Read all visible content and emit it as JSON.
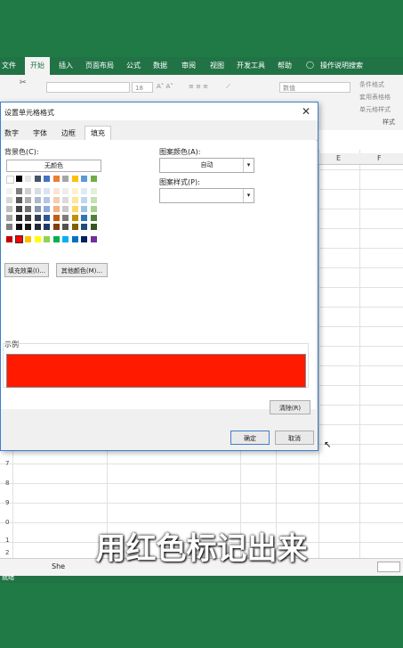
{
  "ribbon": {
    "tabs": [
      "文件",
      "开始",
      "插入",
      "页面布局",
      "公式",
      "数据",
      "审阅",
      "视图",
      "开发工具",
      "帮助"
    ],
    "search_label": "操作说明搜索",
    "font_size": "18",
    "number_format": "数值",
    "conditional_format": "条件格式",
    "table_format": "套用表格格",
    "cell_style": "单元格样式",
    "style_group": "样式"
  },
  "sheet": {
    "columns": [
      "E",
      "F"
    ],
    "rows": [
      "7",
      "8",
      "9",
      "0",
      "1",
      "2"
    ],
    "sheet_tab": "She",
    "status_left": "就绪"
  },
  "dialog": {
    "title": "设置单元格格式",
    "tabs": [
      "数字",
      "字体",
      "边框",
      "填充"
    ],
    "active_tab": "填充",
    "bg_color_label": "背景色(C):",
    "no_color": "无颜色",
    "fill_effects": "填充效果(I)...",
    "more_colors": "其他颜色(M)...",
    "pattern_color_label": "图案颜色(A):",
    "pattern_color_value": "自动",
    "pattern_style_label": "图案样式(P):",
    "sample_label": "示例",
    "clear_button": "清除(R)",
    "ok_button": "确定",
    "cancel_button": "取消",
    "selected_color": "#ff1a00"
  },
  "subtitle": "用红色标记出来"
}
